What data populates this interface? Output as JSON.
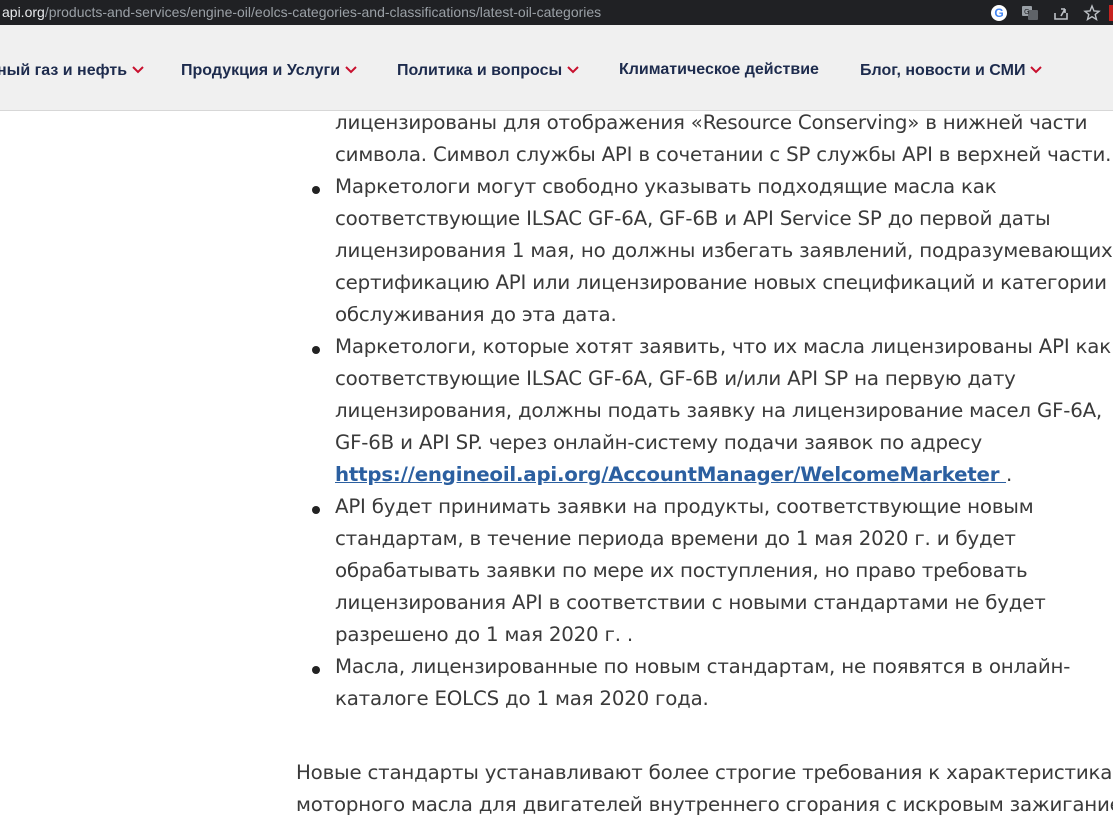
{
  "browser": {
    "url_host": "api.org",
    "url_path": "/products-and-services/engine-oil/eolcs-categories-and-classifications/latest-oil-categories",
    "icons": [
      "google-icon",
      "translate-icon",
      "share-icon",
      "star-icon"
    ]
  },
  "nav": {
    "items": [
      {
        "label": "ный газ и нефть"
      },
      {
        "label": "Продукция и Услуги"
      },
      {
        "label": "Политика и вопросы"
      },
      {
        "label": "Климатическое действие"
      },
      {
        "label": "Блог, новости и СМИ"
      }
    ]
  },
  "content": {
    "top_lines": [
      "лицензированы для отображения «Resource Conserving» в нижней части",
      "символа. Символ службы API в сочетании с SP службы API в верхней части."
    ],
    "bullets": [
      {
        "lines": [
          "Маркетологи могут свободно указывать подходящие масла как",
          "соответствующие ILSAC GF-6A, GF-6B и API Service SP до первой даты",
          "лицензирования 1 мая, но должны избегать заявлений, подразумевающих",
          "сертификацию API или лицензирование новых спецификаций и категории",
          "обслуживания до эта дата."
        ]
      },
      {
        "lines": [
          "Маркетологи, которые хотят заявить, что их масла лицензированы API как",
          "соответствующие ILSAC GF-6A, GF-6B и/или API SP на первую дату",
          "лицензирования, должны подать заявку на лицензирование масел GF-6A,",
          "GF-6B и API SP. через онлайн-систему подачи заявок по адресу"
        ],
        "link": "https://engineoil.api.org/AccountManager/WelcomeMarketer ",
        "link_suffix": "."
      },
      {
        "lines": [
          "API будет принимать заявки на продукты, соответствующие новым",
          "стандартам, в течение периода времени до 1 мая 2020 г. и будет",
          "обрабатывать заявки по мере их поступления, но право требовать",
          "лицензирования API в соответствии с новыми стандартами не будет",
          "разрешено до 1 мая 2020 г. ."
        ]
      },
      {
        "lines": [
          "Масла, лицензированные по новым стандартам, не появятся в онлайн-",
          "каталоге EOLCS до 1 мая 2020 года."
        ]
      }
    ],
    "paragraph_lines": [
      "Новые стандарты устанавливают более строгие требования к характеристикам",
      "моторного масла для двигателей внутреннего сгорания с искровым зажиганием"
    ]
  }
}
